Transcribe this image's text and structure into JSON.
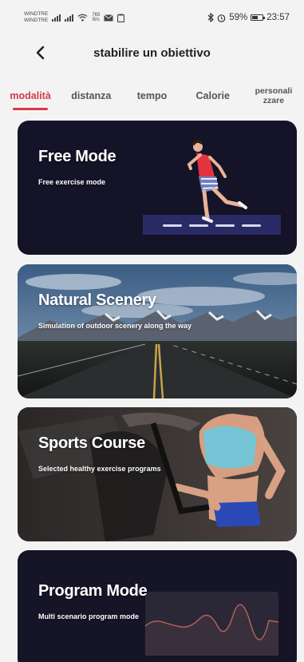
{
  "status_bar": {
    "carrier_1": "WINDTRE",
    "carrier_2": "WINDTRE",
    "net_speed_value": "765",
    "net_speed_unit": "B/s",
    "battery_text": "59%",
    "battery_level": 0.59,
    "time": "23:57"
  },
  "header": {
    "title": "stabilire un obiettivo"
  },
  "tabs": [
    {
      "label": "modalità",
      "active": true
    },
    {
      "label": "distanza",
      "active": false
    },
    {
      "label": "tempo",
      "active": false
    },
    {
      "label": "Calorie",
      "active": false
    },
    {
      "label": "personalizzare",
      "active": false
    }
  ],
  "cards": [
    {
      "title": "Free Mode",
      "subtitle": "Free exercise mode"
    },
    {
      "title": "Natural Scenery",
      "subtitle": "Simulation of outdoor scenery along the way"
    },
    {
      "title": "Sports Course",
      "subtitle": "Selected healthy exercise programs"
    },
    {
      "title": "Program Mode",
      "subtitle": "Multi scenario program mode"
    }
  ],
  "colors": {
    "accent": "#d63a47",
    "card_dark": "#141327"
  }
}
